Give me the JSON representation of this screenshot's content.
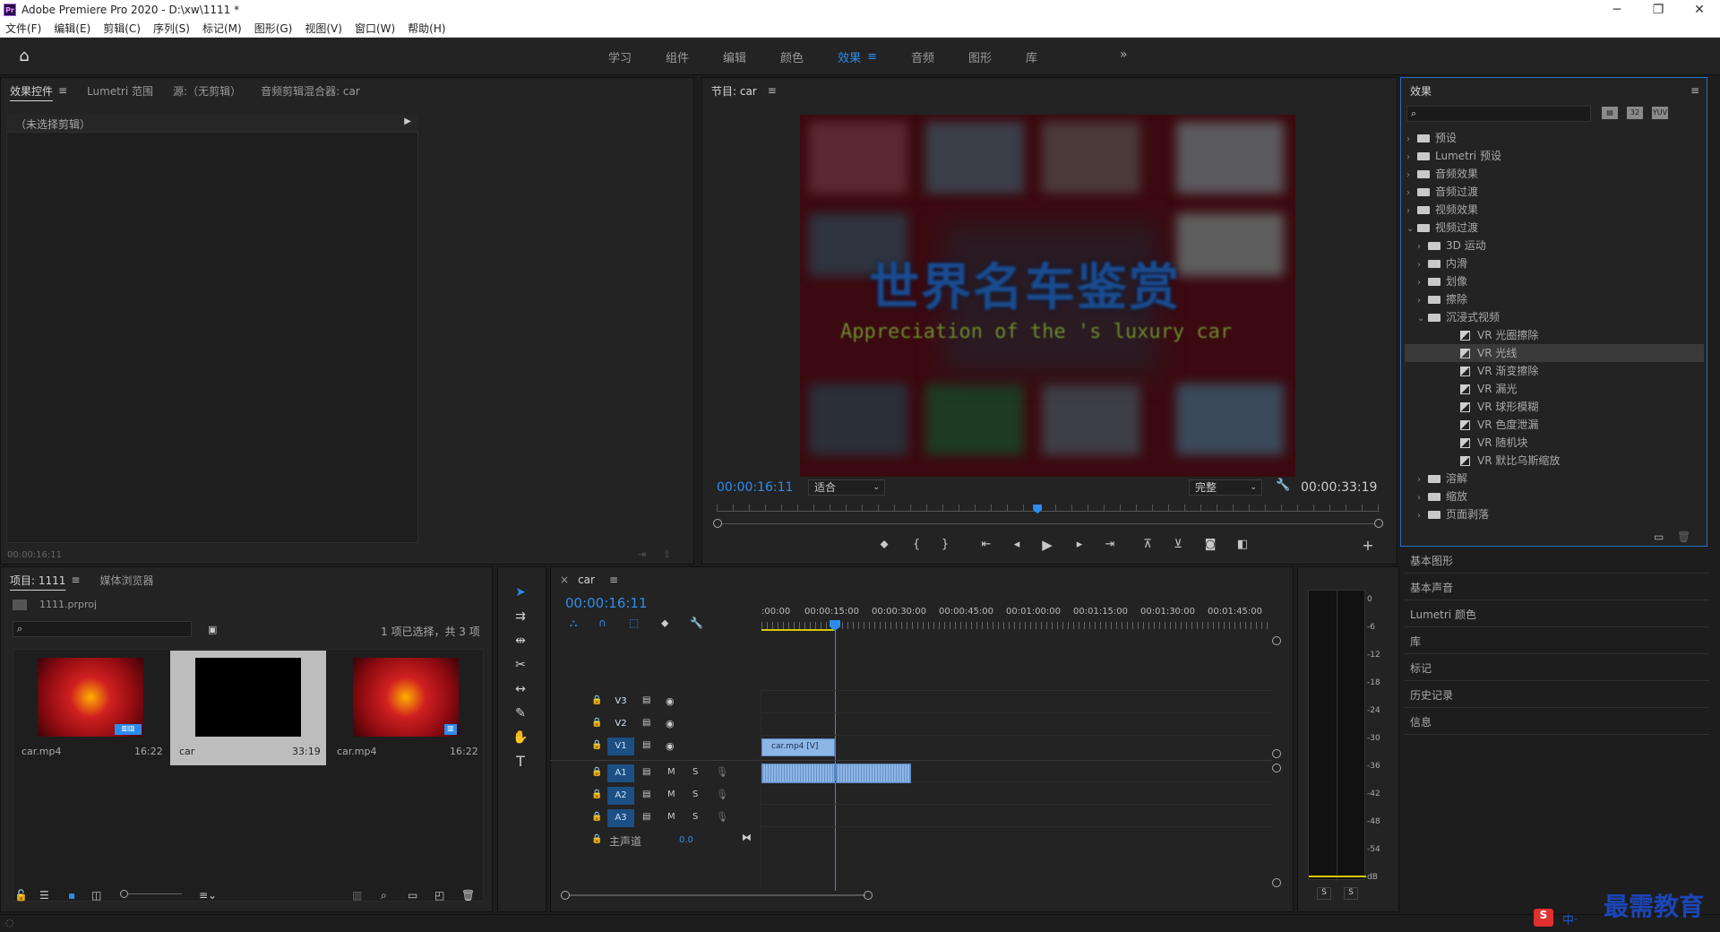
{
  "window": {
    "title": "Adobe Premiere Pro 2020 - D:\\xw\\1111 *",
    "logo": "Pr",
    "minimize": "─",
    "maximize": "❐",
    "close": "✕"
  },
  "menu": [
    "文件(F)",
    "编辑(E)",
    "剪辑(C)",
    "序列(S)",
    "标记(M)",
    "图形(G)",
    "视图(V)",
    "窗口(W)",
    "帮助(H)"
  ],
  "workspaces": {
    "tabs": [
      "学习",
      "组件",
      "编辑",
      "颜色",
      "效果",
      "音频",
      "图形",
      "库"
    ],
    "active": "效果",
    "more": "»"
  },
  "effect_controls": {
    "tabs": [
      "效果控件",
      "Lumetri 范围",
      "源:（无剪辑）",
      "音频剪辑混合器: car"
    ],
    "no_clip": "（未选择剪辑）",
    "time": "00:00:16:11"
  },
  "program_monitor": {
    "title": "节目: car",
    "current_time": "00:00:16:11",
    "fit": "适合",
    "quality": "完整",
    "duration": "00:00:33:19",
    "video_title_cn": "世界名车鉴赏",
    "video_title_en": "Appreciation of the   's luxury car",
    "playhead_fraction": 0.484
  },
  "effects_panel": {
    "title": "效果",
    "items": [
      {
        "label": "预设",
        "indent": 0,
        "type": "folder",
        "state": "closed"
      },
      {
        "label": "Lumetri 预设",
        "indent": 0,
        "type": "folder",
        "state": "closed"
      },
      {
        "label": "音频效果",
        "indent": 0,
        "type": "folder",
        "state": "closed"
      },
      {
        "label": "音频过渡",
        "indent": 0,
        "type": "folder",
        "state": "closed"
      },
      {
        "label": "视频效果",
        "indent": 0,
        "type": "folder",
        "state": "closed"
      },
      {
        "label": "视频过渡",
        "indent": 0,
        "type": "folder",
        "state": "open"
      },
      {
        "label": "3D 运动",
        "indent": 1,
        "type": "folder",
        "state": "closed"
      },
      {
        "label": "内滑",
        "indent": 1,
        "type": "folder",
        "state": "closed"
      },
      {
        "label": "划像",
        "indent": 1,
        "type": "folder",
        "state": "closed"
      },
      {
        "label": "擦除",
        "indent": 1,
        "type": "folder",
        "state": "closed"
      },
      {
        "label": "沉浸式视频",
        "indent": 1,
        "type": "folder",
        "state": "open"
      },
      {
        "label": "VR 光圈擦除",
        "indent": 2,
        "type": "effect"
      },
      {
        "label": "VR 光线",
        "indent": 2,
        "type": "effect",
        "selected": true
      },
      {
        "label": "VR 渐变擦除",
        "indent": 2,
        "type": "effect"
      },
      {
        "label": "VR 漏光",
        "indent": 2,
        "type": "effect"
      },
      {
        "label": "VR 球形模糊",
        "indent": 2,
        "type": "effect"
      },
      {
        "label": "VR 色度泄漏",
        "indent": 2,
        "type": "effect"
      },
      {
        "label": "VR 随机块",
        "indent": 2,
        "type": "effect"
      },
      {
        "label": "VR 默比乌斯缩放",
        "indent": 2,
        "type": "effect"
      },
      {
        "label": "溶解",
        "indent": 1,
        "type": "folder",
        "state": "closed"
      },
      {
        "label": "缩放",
        "indent": 1,
        "type": "folder",
        "state": "closed"
      },
      {
        "label": "页面剥落",
        "indent": 1,
        "type": "folder",
        "state": "closed"
      }
    ],
    "other_panels": [
      "基本图形",
      "基本声音",
      "Lumetri 颜色",
      "库",
      "标记",
      "历史记录",
      "信息"
    ]
  },
  "project": {
    "tabs": [
      "项目: 1111",
      "媒体浏览器"
    ],
    "file": "1111.prproj",
    "selection": "1 项已选择，共 3 项",
    "items": [
      {
        "name": "car.mp4",
        "duration": "16:22"
      },
      {
        "name": "car",
        "duration": "33:19"
      },
      {
        "name": "car.mp4",
        "duration": "16:22"
      }
    ]
  },
  "timeline": {
    "sequence": "car",
    "current_time": "00:00:16:11",
    "ruler": [
      ":00:00",
      "00:00:15:00",
      "00:00:30:00",
      "00:00:45:00",
      "00:01:00:00",
      "00:01:15:00",
      "00:01:30:00",
      "00:01:45:00"
    ],
    "video_tracks": [
      "V3",
      "V2",
      "V1"
    ],
    "audio_tracks": [
      "A1",
      "A2",
      "A3"
    ],
    "master": "主声道",
    "master_value": "0.0",
    "clip_label": "car.mp4 [V]",
    "mute": "M",
    "solo": "S"
  },
  "audio_meter": {
    "labels": [
      "0",
      "-6",
      "-12",
      "-18",
      "-24",
      "-30",
      "-36",
      "-42",
      "-48",
      "-54",
      "dB"
    ],
    "solo_buttons": [
      "S",
      "S"
    ]
  },
  "watermark": "最需教育",
  "ime": "中·"
}
